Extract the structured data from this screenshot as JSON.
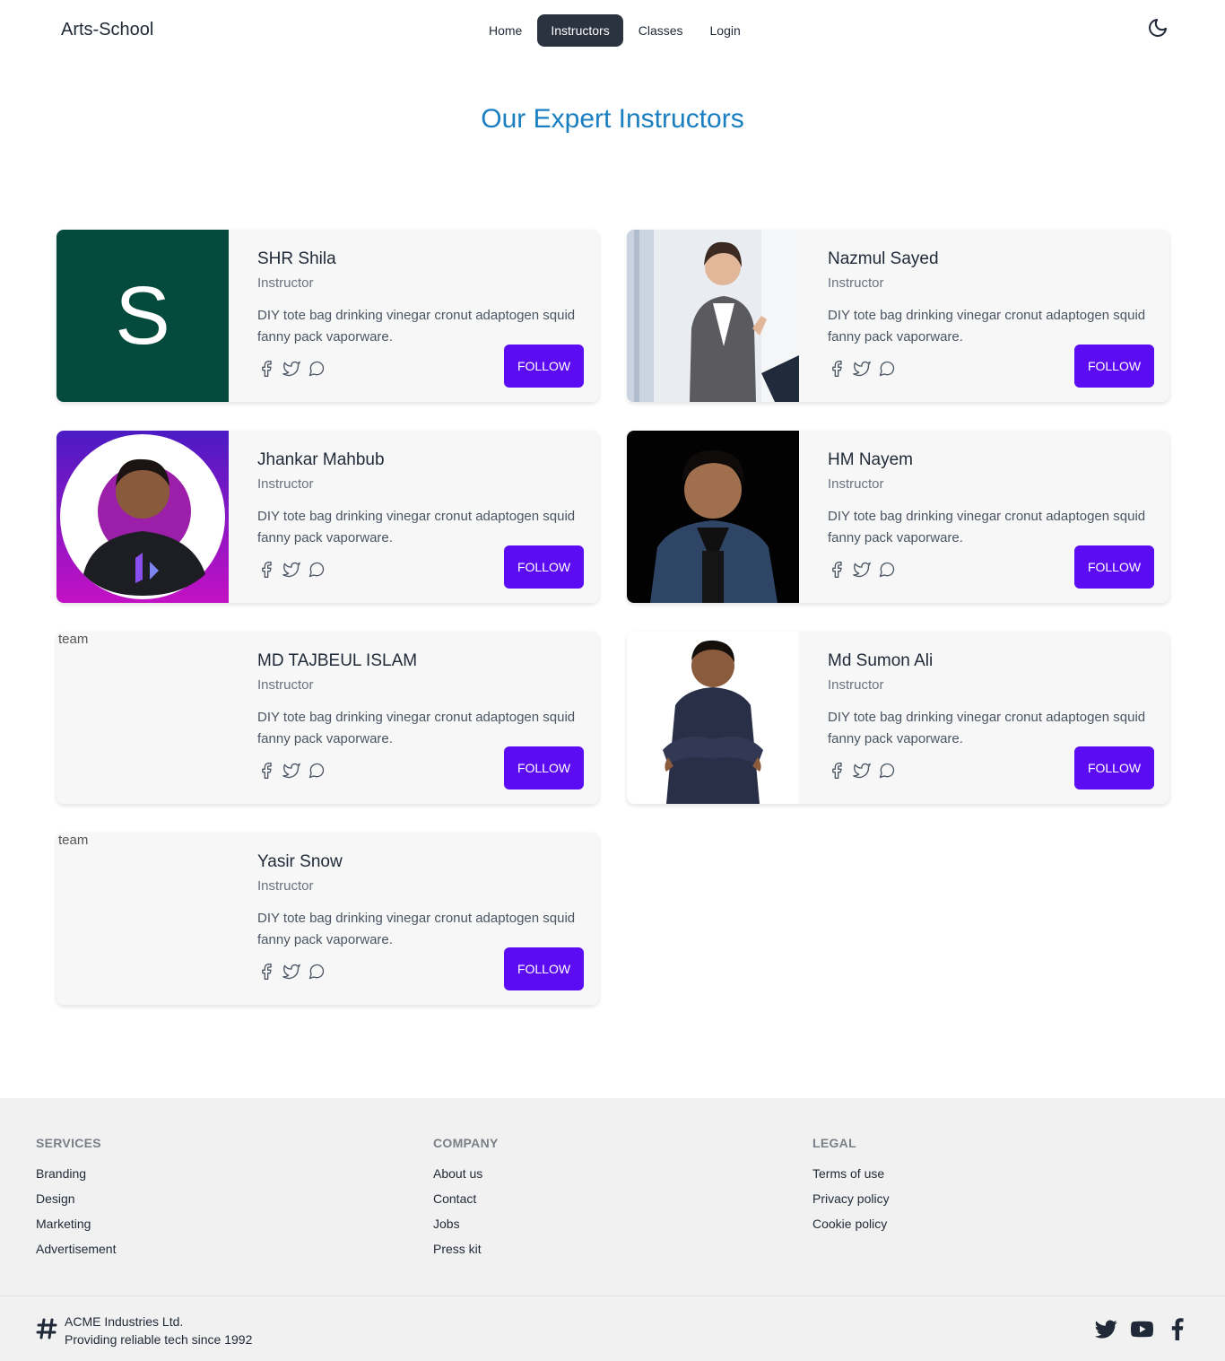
{
  "nav": {
    "brand": "Arts-School",
    "items": [
      {
        "label": "Home",
        "active": false
      },
      {
        "label": "Instructors",
        "active": true
      },
      {
        "label": "Classes",
        "active": false
      },
      {
        "label": "Login",
        "active": false
      }
    ],
    "theme_icon": "moon-icon"
  },
  "page": {
    "title": "Our Expert Instructors"
  },
  "instructors": [
    {
      "name": "SHR Shila",
      "role": "Instructor",
      "desc": "DIY tote bag drinking vinegar cronut adaptogen squid fanny pack vaporware.",
      "follow": "FOLLOW",
      "photo": "letter-avatar",
      "letter": "S"
    },
    {
      "name": "Nazmul Sayed",
      "role": "Instructor",
      "desc": "DIY tote bag drinking vinegar cronut adaptogen squid fanny pack vaporware.",
      "follow": "FOLLOW",
      "photo": "presenter-photo"
    },
    {
      "name": "Jhankar Mahbub",
      "role": "Instructor",
      "desc": "DIY tote bag drinking vinegar cronut adaptogen squid fanny pack vaporware.",
      "follow": "FOLLOW",
      "photo": "circle-portrait"
    },
    {
      "name": "HM Nayem",
      "role": "Instructor",
      "desc": "DIY tote bag drinking vinegar cronut adaptogen squid fanny pack vaporware.",
      "follow": "FOLLOW",
      "photo": "dark-portrait"
    },
    {
      "name": "MD TAJBEUL ISLAM",
      "role": "Instructor",
      "desc": "DIY tote bag drinking vinegar cronut adaptogen squid fanny pack vaporware.",
      "follow": "FOLLOW",
      "photo": "broken",
      "alt": "team"
    },
    {
      "name": "Md Sumon Ali",
      "role": "Instructor",
      "desc": "DIY tote bag drinking vinegar cronut adaptogen squid fanny pack vaporware.",
      "follow": "FOLLOW",
      "photo": "standing-portrait"
    },
    {
      "name": "Yasir Snow",
      "role": "Instructor",
      "desc": "DIY tote bag drinking vinegar cronut adaptogen squid fanny pack vaporware.",
      "follow": "FOLLOW",
      "photo": "broken",
      "alt": "team"
    }
  ],
  "card_social_icons": [
    "facebook-icon",
    "twitter-icon",
    "chat-icon"
  ],
  "footer": {
    "columns": [
      {
        "heading": "SERVICES",
        "links": [
          "Branding",
          "Design",
          "Marketing",
          "Advertisement"
        ]
      },
      {
        "heading": "COMPANY",
        "links": [
          "About us",
          "Contact",
          "Jobs",
          "Press kit"
        ]
      },
      {
        "heading": "LEGAL",
        "links": [
          "Terms of use",
          "Privacy policy",
          "Cookie policy"
        ]
      }
    ],
    "company_line1": "ACME Industries Ltd.",
    "company_line2": "Providing reliable tech since 1992",
    "social_icons": [
      "twitter-icon",
      "youtube-icon",
      "facebook-icon"
    ]
  },
  "colors": {
    "accent": "#5b0cf2",
    "title": "#1a7fc1",
    "nav_active_bg": "#2b3240",
    "card_bg": "#f7f7f7",
    "footer_bg": "#f1f1f1"
  }
}
